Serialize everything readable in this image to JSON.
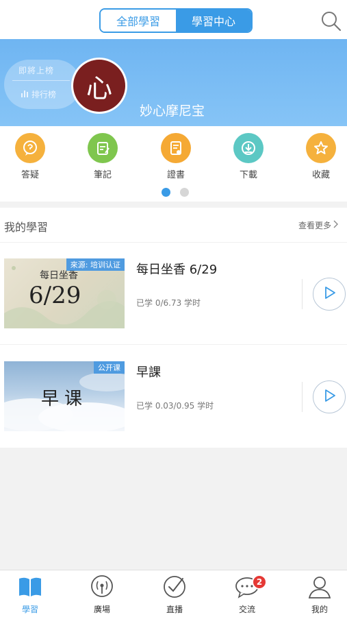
{
  "header": {
    "tabs": [
      {
        "label": "全部學習",
        "active": false
      },
      {
        "label": "學習中心",
        "active": true
      }
    ],
    "search_icon": "search-icon"
  },
  "banner": {
    "rank_top": "即將上榜",
    "rank_bottom": "排行榜",
    "avatar_char": "心",
    "username": "妙心摩尼宝"
  },
  "quick_menu": {
    "items": [
      {
        "label": "答疑",
        "icon": "qa-icon",
        "color": "#f5b13d"
      },
      {
        "label": "筆記",
        "icon": "note-icon",
        "color": "#7fc64e"
      },
      {
        "label": "證書",
        "icon": "certificate-icon",
        "color": "#f5a934"
      },
      {
        "label": "下載",
        "icon": "download-icon",
        "color": "#5cc8c4"
      },
      {
        "label": "收藏",
        "icon": "star-icon",
        "color": "#f5b13d"
      }
    ],
    "page_count": 2,
    "current_page": 1
  },
  "my_study": {
    "title": "我的學習",
    "more": "查看更多",
    "courses": [
      {
        "badge": "來源: 培训认证",
        "thumb_top": "每日坐香",
        "thumb_main": "6/29",
        "title": "每日坐香 6/29",
        "progress": "已学 0/6.73 学时"
      },
      {
        "badge": "公开课",
        "thumb_main": "早课",
        "title": "早課",
        "progress": "已学 0.03/0.95 学时"
      }
    ]
  },
  "tabbar": {
    "items": [
      {
        "label": "學習",
        "icon": "book-icon",
        "active": true
      },
      {
        "label": "廣場",
        "icon": "broadcast-icon",
        "active": false
      },
      {
        "label": "直播",
        "icon": "check-circle-icon",
        "active": false
      },
      {
        "label": "交流",
        "icon": "chat-icon",
        "active": false,
        "badge": "2"
      },
      {
        "label": "我的",
        "icon": "person-icon",
        "active": false
      }
    ]
  },
  "colors": {
    "accent": "#3a9be6",
    "badge_red": "#e53935"
  }
}
